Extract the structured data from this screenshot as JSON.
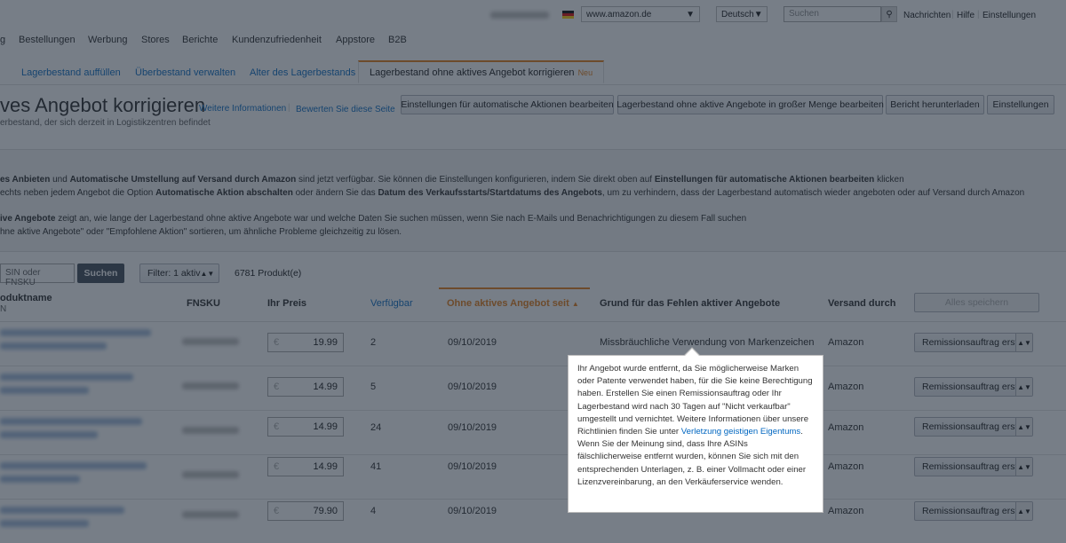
{
  "topbar": {
    "marketplace_select": "www.amazon.de",
    "language_select": "Deutsch",
    "search_placeholder": "Suchen",
    "links": [
      "Nachrichten",
      "Hilfe",
      "Einstellungen"
    ]
  },
  "main_nav": [
    "g",
    "Bestellungen",
    "Werbung",
    "Stores",
    "Berichte",
    "Kundenzufriedenheit",
    "Appstore",
    "B2B"
  ],
  "sub_tabs": {
    "items": [
      "Lagerbestand auffüllen",
      "Überbestand verwalten",
      "Alter des Lagerbestands",
      "Lagerbestand ohne aktives Angebot korrigieren"
    ],
    "active_badge": "Neu"
  },
  "page": {
    "title": "ves Angebot korrigieren",
    "more_info_link": "Weitere Informationen",
    "rate_link": "Bewerten Sie diese Seite",
    "subtitle": "erbestand, der sich derzeit in Logistikzentren befindet",
    "buttons": [
      "Einstellungen für automatische Aktionen bearbeiten",
      "Lagerbestand ohne aktive Angebote in großer Menge bearbeiten",
      "Bericht herunterladen",
      "Einstellungen"
    ]
  },
  "info": {
    "line1_a": "es Anbieten",
    "line1_b": " und ",
    "line1_c": "Automatische Umstellung auf Versand durch Amazon",
    "line1_d": " sind jetzt verfügbar. Sie können die Einstellungen konfigurieren, indem Sie direkt oben auf ",
    "line1_e": "Einstellungen für automatische Aktionen bearbeiten",
    "line1_f": " klicken",
    "line2_a": "echts neben jedem Angebot die Option ",
    "line2_b": "Automatische Aktion abschalten",
    "line2_c": " oder ändern Sie das ",
    "line2_d": "Datum des Verkaufsstarts/Startdatums des Angebots",
    "line2_e": ", um zu verhindern, dass der Lagerbestand automatisch wieder angeboten oder auf Versand durch Amazon",
    "line3_a": "ive Angebote",
    "line3_b": " zeigt an, wie lange der Lagerbestand ohne aktive Angebote war und welche Daten Sie suchen müssen, wenn Sie nach E-Mails und Benachrichtigungen zu diesem Fall suchen",
    "line4": "hne aktive Angebote\" oder \"Empfohlene Aktion\" sortieren, um ähnliche Probleme gleichzeitig zu lösen."
  },
  "filterbar": {
    "search_placeholder": "SIN oder FNSKU",
    "search_button": "Suchen",
    "filter_select": "Filter: 1 aktiv",
    "product_count": "6781 Produkt(e)"
  },
  "table": {
    "headers": {
      "product_name": "oduktname",
      "product_sub": "N",
      "fnsku": "FNSKU",
      "price": "Ihr Preis",
      "available": "Verfügbar",
      "inactive_since": "Ohne aktives Angebot seit",
      "reason": "Grund für das Fehlen aktiver Angebote",
      "shipping": "Versand durch",
      "save_all": "Alles speichern"
    },
    "currency": "€",
    "rows": [
      {
        "price": "19.99",
        "available": "2",
        "date": "09/10/2019",
        "reason": "Missbräuchliche Verwendung von Markenzeichen",
        "shipping": "Amazon",
        "action": "Remissionsauftrag erstellen"
      },
      {
        "price": "14.99",
        "available": "5",
        "date": "09/10/2019",
        "reason": "",
        "shipping": "Amazon",
        "action": "Remissionsauftrag erstellen"
      },
      {
        "price": "14.99",
        "available": "24",
        "date": "09/10/2019",
        "reason": "",
        "shipping": "Amazon",
        "action": "Remissionsauftrag erstellen"
      },
      {
        "price": "14.99",
        "available": "41",
        "date": "09/10/2019",
        "reason": "",
        "shipping": "Amazon",
        "action": "Remissionsauftrag erstellen"
      },
      {
        "price": "79.90",
        "available": "4",
        "date": "09/10/2019",
        "reason": "",
        "shipping": "Amazon",
        "action": "Remissionsauftrag erstellen"
      }
    ]
  },
  "tooltip": {
    "text_a": "Ihr Angebot wurde entfernt, da Sie möglicherweise Marken oder Patente verwendet haben, für die Sie keine Berechtigung haben. Erstellen Sie einen Remissionsauftrag oder Ihr Lagerbestand wird nach 30 Tagen auf \"Nicht verkaufbar\" umgestellt und vernichtet. Weitere Informationen über unsere Richtlinien finden Sie unter ",
    "link": "Verletzung geistigen Eigentums",
    "text_b": ". Wenn Sie der Meinung sind, dass Ihre ASINs fälschlicherweise entfernt wurden, können Sie sich mit den entsprechenden Unterlagen, z. B. einer Vollmacht oder einer Lizenzvereinbarung, an den Verkäuferservice wenden."
  }
}
